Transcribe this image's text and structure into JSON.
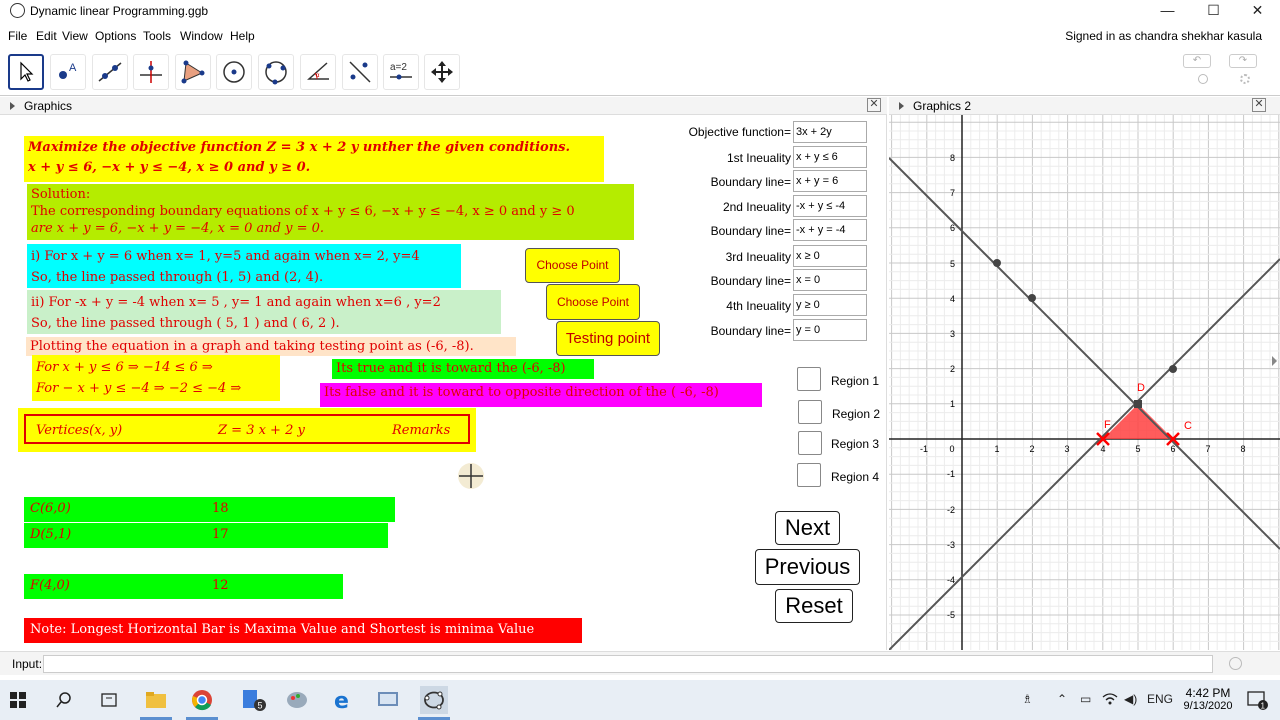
{
  "window": {
    "title": "Dynamic linear Programming.ggb",
    "minimize": "—",
    "maximize": "☐",
    "close": "✕"
  },
  "menu": {
    "items": [
      "File",
      "Edit",
      "View",
      "Options",
      "Tools",
      "Window",
      "Help"
    ],
    "signed_in": "Signed in as chandra shekhar kasula"
  },
  "toolbar": {
    "tools": [
      "move-tool",
      "point-tool",
      "line-tool",
      "perpendicular-line-tool",
      "polygon-tool",
      "circle-tool",
      "circle-three-points-tool",
      "angle-tool",
      "reflect-tool",
      "slider-tool",
      "move-graphics-view-tool"
    ],
    "slider_label": "a=2",
    "undo": "↶",
    "redo": "↷"
  },
  "panels": {
    "graphics": "Graphics",
    "graphics2": "Graphics 2",
    "close": "✕"
  },
  "problem": {
    "line1": "Maximize the objective function Z = 3 x + 2 y unther the given conditions.",
    "line2": "x + y ≤ 6,  −x + y ≤ −4,  x ≥ 0 and y ≥ 0."
  },
  "solution": {
    "line1": "Solution:",
    "line2": "The corresponding boundary equations of x + y ≤ 6,  −x + y ≤ −4,  x ≥ 0 and y ≥ 0",
    "line3": "are x + y = 6,  −x + y = −4,  x = 0 and y = 0."
  },
  "step1": {
    "line1": "i) For x + y = 6 when x= 1, y=5 and again when x= 2, y=4",
    "line2": "So, the line passed through (1, 5) and (2, 4)."
  },
  "step2": {
    "line1": "ii) For  -x + y = -4 when x= 5 , y= 1 and again when x=6  , y=2",
    "line2": "So, the line passed through ( 5, 1 ) and ( 6, 2 )."
  },
  "plotting": "Plotting the equation in a graph and taking testing point as (-6, -8).",
  "tests": {
    "t1": "For x + y ≤ 6 ⇒ −14 ≤ 6 ⇒",
    "t2": "For  − x + y ≤ −4 ⇒ −2 ≤ −4 ⇒",
    "true_msg": "Its true and it is toward the (-6, -8)",
    "false_msg": "Its false and it is toward to opposite direction of the ( -6,  -8)"
  },
  "buttons": {
    "choose1": "Choose Point",
    "choose2": "Choose Point",
    "testing": "Testing point",
    "next": "Next",
    "previous": "Previous",
    "reset": "Reset"
  },
  "table_header": {
    "col1": "Vertices(x, y)",
    "col2": "Z = 3 x + 2 y",
    "col3": "Remarks"
  },
  "vertex_rows": [
    {
      "vertex": "C(6,0)",
      "z": "18",
      "z_value": 18
    },
    {
      "vertex": "D(5,1)",
      "z": "17",
      "z_value": 17
    },
    {
      "vertex": "F(4,0)",
      "z": "12",
      "z_value": 12
    }
  ],
  "note": "Note: Longest Horizontal Bar is Maxima Value and Shortest is minima Value",
  "fields": [
    {
      "label": "Objective function=",
      "value": "3x + 2y"
    },
    {
      "label": "1st Ineuality",
      "value": "x + y ≤ 6"
    },
    {
      "label": "Boundary line=",
      "value": "x + y = 6"
    },
    {
      "label": "2nd Ineuality",
      "value": "-x + y ≤ -4"
    },
    {
      "label": "Boundary line=",
      "value": "-x + y = -4"
    },
    {
      "label": "3rd Ineuality",
      "value": "x ≥ 0"
    },
    {
      "label": "Boundary line=",
      "value": "x = 0"
    },
    {
      "label": "4th Ineuality",
      "value": "y ≥ 0"
    },
    {
      "label": "Boundary line=",
      "value": "y = 0"
    }
  ],
  "regions": [
    "Region 1",
    "Region 2",
    "Region 3",
    "Region 4"
  ],
  "graph": {
    "x_ticks": [
      "-1",
      "0",
      "1",
      "2",
      "3",
      "4",
      "5",
      "6",
      "7",
      "8"
    ],
    "y_ticks_pos": [
      "8",
      "7",
      "6",
      "5",
      "4",
      "3",
      "2",
      "1"
    ],
    "y_ticks_neg": [
      "-1",
      "-2",
      "-3",
      "-4",
      "-5"
    ],
    "labels": {
      "D": "D",
      "C": "C",
      "F": "F"
    },
    "shade_color": "#ff4040"
  },
  "input_bar": {
    "label": "Input:"
  },
  "taskbar": {
    "time": "4:42 PM",
    "date": "9/13/2020",
    "lang": "ENG",
    "badge": "5",
    "notif": "1"
  }
}
